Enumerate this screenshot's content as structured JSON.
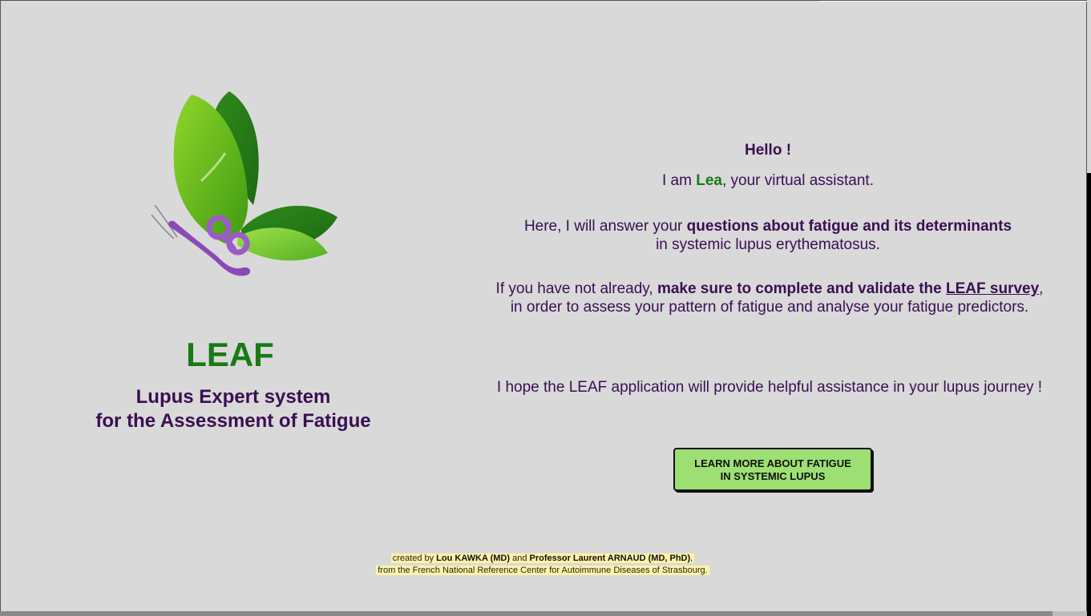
{
  "brand": {
    "name": "LEAF",
    "subtitle_line1": "Lupus Expert system",
    "subtitle_line2": "for the Assessment of Fatigue",
    "logo_icon": "leaf-butterfly-icon",
    "colors": {
      "green": "#1a7a16",
      "purple": "#3a0f52",
      "background": "#d9d9d9",
      "button": "#9ddf72",
      "credits_highlight": "#fff3a6"
    }
  },
  "main": {
    "greeting": "Hello !",
    "intro_prefix": "I am ",
    "assistant_name": "Lea",
    "intro_suffix": ", your virtual assistant.",
    "para1_prefix": "Here, I will answer your ",
    "para1_bold": "questions about fatigue and its determinants",
    "para1_line2": "in systemic lupus erythematosus.",
    "para2_prefix": "If you have not already, ",
    "para2_bold": "make sure to complete and validate the ",
    "para2_link": "LEAF survey",
    "para2_after_link": ",",
    "para2_line2": "in order to assess your pattern of fatigue and analyse your fatigue predictors.",
    "para3": "I hope the LEAF application will provide helpful assistance in your lupus journey !",
    "learn_button_line1": "LEARN MORE ABOUT FATIGUE",
    "learn_button_line2": "IN SYSTEMIC LUPUS"
  },
  "footer": {
    "created_by": "created by ",
    "author1": "Lou KAWKA (MD)",
    "and": " and ",
    "author2": "Professor Laurent ARNAUD (MD, PhD)",
    "comma": ",",
    "line2": "from the French National Reference Center for Autoimmune Diseases of Strasbourg."
  }
}
